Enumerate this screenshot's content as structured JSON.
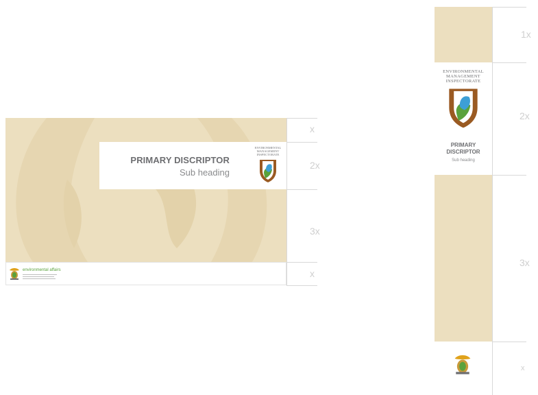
{
  "colors": {
    "sand": "#ecdfbf",
    "guide": "#d8d8d8",
    "multiplier": "#cfcfcf",
    "title": "#6d6e71",
    "green": "#5aa23c"
  },
  "horizontal": {
    "panel": {
      "title": "PRIMARY DISCRIPTOR",
      "subheading": "Sub heading"
    },
    "emi_logo_lines": [
      "ENVIRONMENTAL",
      "MANAGEMENT",
      "INSPECTORATE"
    ],
    "department_text": "environmental affairs",
    "multipliers": [
      "x",
      "2x",
      "3x",
      "x"
    ]
  },
  "vertical": {
    "emi_logo_lines": [
      "ENVIRONMENTAL",
      "MANAGEMENT",
      "INSPECTORATE"
    ],
    "title_lines": [
      "PRIMARY",
      "DISCRIPTOR"
    ],
    "subheading": "Sub heading",
    "multipliers": [
      "1x",
      "2x",
      "3x",
      "x"
    ]
  },
  "icons": [
    "emi-shield-icon",
    "coat-of-arms-icon"
  ]
}
